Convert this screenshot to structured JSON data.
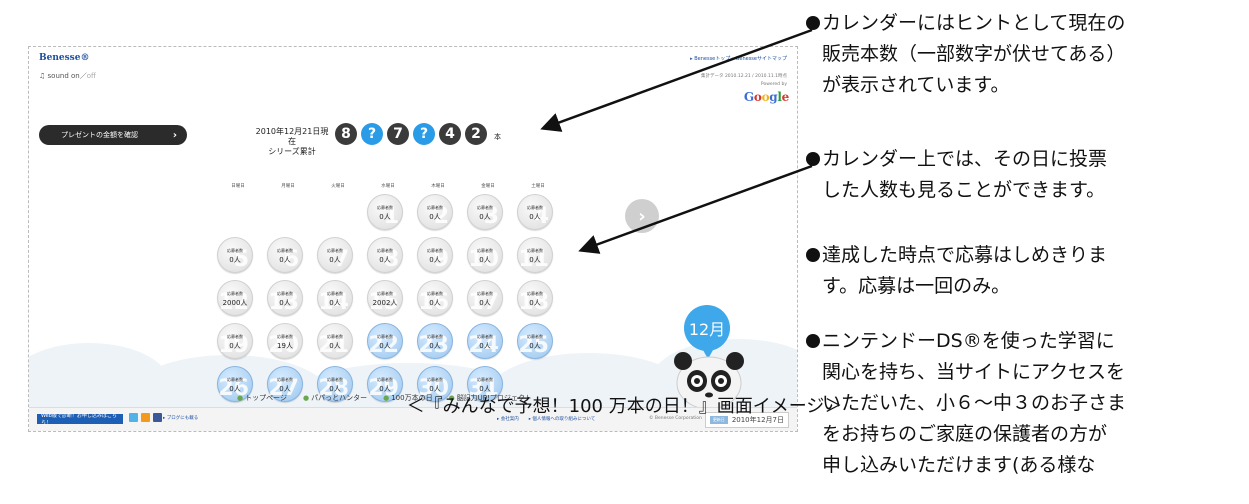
{
  "screenshot": {
    "logo": "Benesse®",
    "sound": {
      "on": "sound on",
      "sep": "／",
      "off": "off"
    },
    "top_links": "▸ Benesseトップ ▸ Benesseサイトマップ",
    "data_note": "集計データ 2010.12.21 / 2010.11.1時点",
    "powered_by": "Powered by",
    "google": [
      "G",
      "o",
      "o",
      "g",
      "l",
      "e"
    ],
    "google_colors": [
      "#3b6fd6",
      "#d6372e",
      "#f1b31c",
      "#3b6fd6",
      "#2c9c3f",
      "#d6372e"
    ],
    "present_button": "プレゼントの金額を確認",
    "date_head_line1": "2010年12月21日現在",
    "date_head_line2": "シリーズ累計",
    "counter_digits": [
      "8",
      "?",
      "7",
      "?",
      "4",
      "2"
    ],
    "counter_unit": "本",
    "weekdays": [
      "日曜日",
      "月曜日",
      "火曜日",
      "水曜日",
      "木曜日",
      "金曜日",
      "土曜日"
    ],
    "cell_label": "応募者数",
    "calendar": [
      {
        "day": "1",
        "count": "0人",
        "col": 3,
        "row": 0,
        "blue": false
      },
      {
        "day": "2",
        "count": "0人",
        "col": 4,
        "row": 0,
        "blue": false
      },
      {
        "day": "3",
        "count": "0人",
        "col": 5,
        "row": 0,
        "blue": false
      },
      {
        "day": "4",
        "count": "0人",
        "col": 6,
        "row": 0,
        "blue": false
      },
      {
        "day": "5",
        "count": "0人",
        "col": 0,
        "row": 1,
        "blue": false
      },
      {
        "day": "6",
        "count": "0人",
        "col": 1,
        "row": 1,
        "blue": false
      },
      {
        "day": "7",
        "count": "0人",
        "col": 2,
        "row": 1,
        "blue": false
      },
      {
        "day": "8",
        "count": "0人",
        "col": 3,
        "row": 1,
        "blue": false
      },
      {
        "day": "9",
        "count": "0人",
        "col": 4,
        "row": 1,
        "blue": false
      },
      {
        "day": "10",
        "count": "0人",
        "col": 5,
        "row": 1,
        "blue": false
      },
      {
        "day": "11",
        "count": "0人",
        "col": 6,
        "row": 1,
        "blue": false
      },
      {
        "day": "12",
        "count": "2000人",
        "col": 0,
        "row": 2,
        "blue": false
      },
      {
        "day": "13",
        "count": "0人",
        "col": 1,
        "row": 2,
        "blue": false
      },
      {
        "day": "14",
        "count": "0人",
        "col": 2,
        "row": 2,
        "blue": false
      },
      {
        "day": "15",
        "count": "2002人",
        "col": 3,
        "row": 2,
        "blue": false
      },
      {
        "day": "16",
        "count": "0人",
        "col": 4,
        "row": 2,
        "blue": false
      },
      {
        "day": "17",
        "count": "0人",
        "col": 5,
        "row": 2,
        "blue": false
      },
      {
        "day": "18",
        "count": "0人",
        "col": 6,
        "row": 2,
        "blue": false
      },
      {
        "day": "19",
        "count": "0人",
        "col": 0,
        "row": 3,
        "blue": false
      },
      {
        "day": "20",
        "count": "19人",
        "col": 1,
        "row": 3,
        "blue": false
      },
      {
        "day": "21",
        "count": "0人",
        "col": 2,
        "row": 3,
        "blue": false
      },
      {
        "day": "22",
        "count": "0人",
        "col": 3,
        "row": 3,
        "blue": true
      },
      {
        "day": "23",
        "count": "0人",
        "col": 4,
        "row": 3,
        "blue": true
      },
      {
        "day": "24",
        "count": "0人",
        "col": 5,
        "row": 3,
        "blue": true
      },
      {
        "day": "25",
        "count": "0人",
        "col": 6,
        "row": 3,
        "blue": true
      },
      {
        "day": "26",
        "count": "0人",
        "col": 0,
        "row": 4,
        "blue": true
      },
      {
        "day": "27",
        "count": "0人",
        "col": 1,
        "row": 4,
        "blue": true
      },
      {
        "day": "28",
        "count": "0人",
        "col": 2,
        "row": 4,
        "blue": true
      },
      {
        "day": "29",
        "count": "0人",
        "col": 3,
        "row": 4,
        "blue": true
      },
      {
        "day": "30",
        "count": "0人",
        "col": 4,
        "row": 4,
        "blue": true
      },
      {
        "day": "31",
        "count": "0人",
        "col": 5,
        "row": 4,
        "blue": true
      }
    ],
    "month_badge": "12月",
    "nav": [
      "トップページ",
      "パパっとハンター",
      "100万本の日",
      "脳記力UP!プロジェクト"
    ],
    "footer_button": "Web版で診断！お申し込みはこちら！",
    "footer_blog": "▸ ブログにも載る",
    "footer_links": [
      "▸ 会社案内",
      "▸ 個人情報への取り組みについて"
    ],
    "footer_copy": "© Benesse Corporation",
    "footer_date_tag": "更新日",
    "footer_date": "2010年12月7日"
  },
  "caption": "＜『みんなで予想！100 万本の日！』画面イメージ＞",
  "notes": [
    {
      "lines": [
        "カレンダーにはヒントとして現在の",
        "販売本数（一部数字が伏せてある）",
        "が表示されています。"
      ]
    },
    {
      "lines": [
        "カレンダー上では、その日に投票",
        "した人数も見ることができます。"
      ]
    },
    {
      "lines": [
        "達成した時点で応募はしめきりま",
        "す。応募は一回のみ。"
      ]
    },
    {
      "lines": [
        "ニンテンドーDS®を使った学習に",
        "関心を持ち、当サイトにアクセスを",
        "いただいた、小６〜中３のお子さま",
        "をお持ちのご家庭の保護者の方が",
        "申し込みいただけます(ある様な"
      ]
    }
  ],
  "colors": {
    "accent_blue": "#3ea8ea",
    "digit_dark": "#3b3b3b",
    "digit_hidden": "#2a9be6",
    "button_dark": "#2b2b2b"
  }
}
